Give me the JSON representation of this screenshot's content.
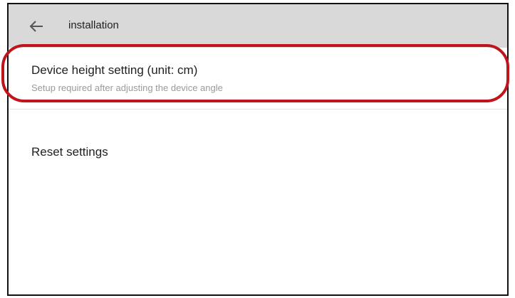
{
  "header": {
    "title": "installation",
    "back_icon": "arrow-left-icon"
  },
  "settings": {
    "items": [
      {
        "title": "Device height setting (unit: cm)",
        "subtitle": "Setup required after adjusting the device angle"
      },
      {
        "title": "Reset settings"
      }
    ]
  },
  "annotation": {
    "highlight_color": "#c0141c"
  },
  "colors": {
    "header_bg": "#d9d9d9",
    "frame_border": "#111111"
  }
}
